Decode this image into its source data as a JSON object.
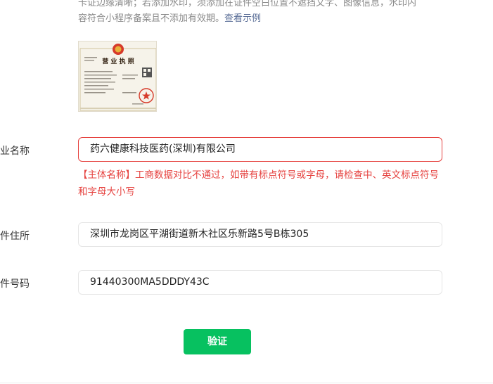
{
  "description": {
    "line1": "卡证边缘清晰；若添加水印，须添加在证件空白位置不遮挡文字、图像信息，水印内",
    "line2_prefix": "容符合小程序备案且不添加有效期。",
    "link_text": "查看示例"
  },
  "license_image": {
    "title": "营 业 执 照"
  },
  "fields": {
    "company_name": {
      "label": "企业名称",
      "value": "药六健康科技医药(深圳)有限公司"
    },
    "address": {
      "label": "证件住所",
      "value": "深圳市龙岗区平湖街道新木社区乐新路5号B栋305"
    },
    "id_number": {
      "label": "证件号码",
      "value": "91440300MA5DDDY43C"
    }
  },
  "error_message": "【主体名称】工商数据对比不通过，如带有标点符号或字母，请检查中、英文标点符号和字母大小写",
  "verify_button": "验证",
  "colors": {
    "accent_green": "#07c160",
    "error_red": "#e64340",
    "link_blue": "#576b95"
  }
}
